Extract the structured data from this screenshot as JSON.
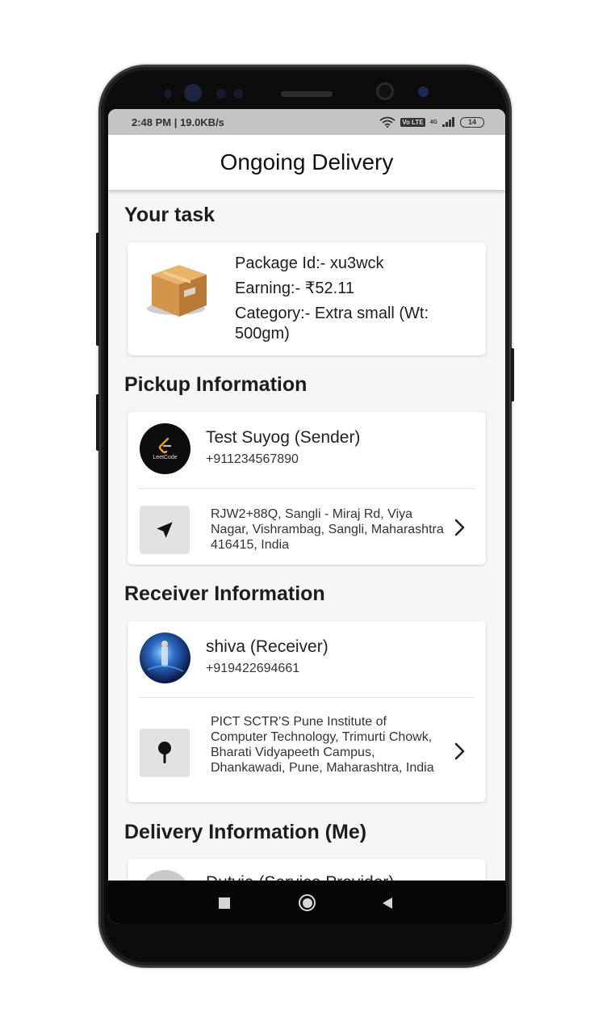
{
  "status_bar": {
    "time": "2:48 PM | 19.0KB/s",
    "network_badge": "Vo LTE",
    "signal_label": "4G",
    "battery": "14"
  },
  "app_bar": {
    "title": "Ongoing Delivery"
  },
  "task": {
    "heading": "Your task",
    "package_id": "Package Id:- xu3wck",
    "earning": "Earning:- ₹52.11",
    "category": "Category:- Extra small (Wt: 500gm)",
    "icon": "package-box-icon"
  },
  "pickup": {
    "heading": "Pickup Information",
    "name": "Test Suyog (Sender)",
    "phone": "+911234567890",
    "avatar_text": "LeetCode",
    "address": "RJW2+88Q, Sangli - Miraj Rd, Viya Nagar, Vishrambag, Sangli, Maharashtra 416415, India",
    "icon": "navigation-arrow-icon"
  },
  "receiver": {
    "heading": "Receiver Information",
    "name": "shiva  (Receiver)",
    "phone": "+919422694661",
    "address": "PICT SCTR'S Pune Institute of Computer Technology, Trimurti Chowk, Bharati Vidyapeeth Campus, Dhankawadi, Pune, Maharashtra, India",
    "icon": "map-pin-icon"
  },
  "delivery": {
    "heading": "Delivery Information (Me)",
    "name_partial": "Dutvia (Service Provider)"
  },
  "colors": {
    "status_bar_bg": "#c4c4c4",
    "app_bar_bg": "#ffffff",
    "screen_bg": "#f6f6f6",
    "nav_bar_bg": "#060606"
  }
}
